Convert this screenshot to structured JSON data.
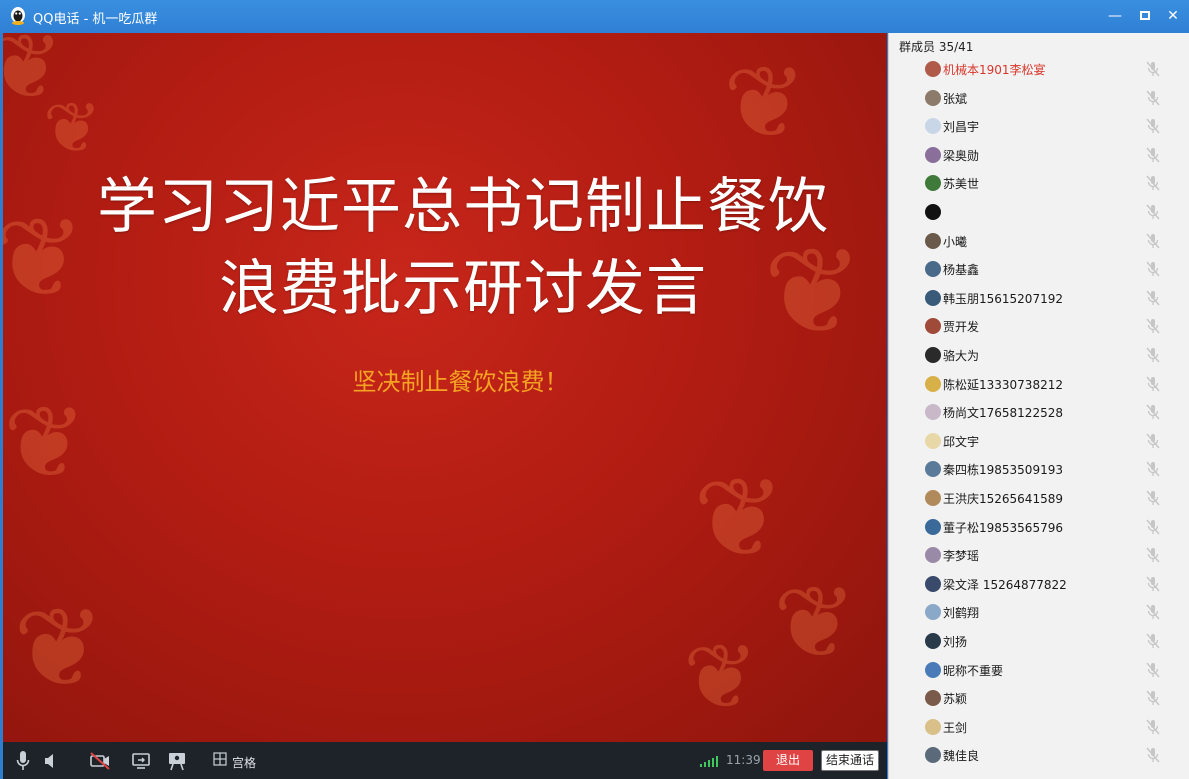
{
  "window": {
    "title": "QQ电话 - 机一吃瓜群",
    "minimize": "—",
    "close": "✕"
  },
  "slide": {
    "title_line1": "学习习近平总书记制止餐饮",
    "title_line2": "浪费批示研讨发言",
    "subtitle": "坚决制止餐饮浪费！"
  },
  "sidebar": {
    "member_count": "群成员 35/41",
    "members": [
      {
        "name": "机械本1901李松宴",
        "avatar_color": "#b05a4a"
      },
      {
        "name": "张斌",
        "avatar_color": "#8c7a6a"
      },
      {
        "name": "刘昌宇",
        "avatar_color": "#c9d6e8"
      },
      {
        "name": "梁奥勋",
        "avatar_color": "#8a6f9a"
      },
      {
        "name": "苏美世",
        "avatar_color": "#3f7a3a"
      },
      {
        "name": "",
        "avatar_color": "#111111"
      },
      {
        "name": "小曦",
        "avatar_color": "#6a5a4a"
      },
      {
        "name": "杨基鑫",
        "avatar_color": "#4a6a8a"
      },
      {
        "name": "韩玉朋15615207192",
        "avatar_color": "#3a5a7a"
      },
      {
        "name": "贾开发",
        "avatar_color": "#a04a3a"
      },
      {
        "name": "骆大为",
        "avatar_color": "#2a2a2a"
      },
      {
        "name": "陈松延13330738212",
        "avatar_color": "#d8b048"
      },
      {
        "name": "杨尚文17658122528",
        "avatar_color": "#c8b8c8"
      },
      {
        "name": "邱文宇",
        "avatar_color": "#e8d8a8"
      },
      {
        "name": "秦四栋19853509193",
        "avatar_color": "#5a7a9a"
      },
      {
        "name": "王洪庆15265641589",
        "avatar_color": "#b08a5a"
      },
      {
        "name": "董子松19853565796",
        "avatar_color": "#3a6a9a"
      },
      {
        "name": "李梦瑶",
        "avatar_color": "#9a8aa8"
      },
      {
        "name": "梁文泽 15264877822",
        "avatar_color": "#3a4a6a"
      },
      {
        "name": "刘鹤翔",
        "avatar_color": "#8aa8c8"
      },
      {
        "name": "刘扬",
        "avatar_color": "#2a3a4a"
      },
      {
        "name": "昵称不重要",
        "avatar_color": "#4a7ab8"
      },
      {
        "name": "苏颖",
        "avatar_color": "#7a5a4a"
      },
      {
        "name": "王剑",
        "avatar_color": "#d8c088"
      },
      {
        "name": "魏佳良",
        "avatar_color": "#5a6a7a"
      }
    ]
  },
  "toolbar": {
    "grid_label": "宫格",
    "time": "11:39",
    "exit_label": "退出",
    "end_call_label": "结束通话"
  },
  "colors": {
    "titlebar": "#2f80d4",
    "slide_bg": "#b11c12",
    "subtitle": "#f5a323",
    "self_name": "#d9362b",
    "exit_button": "#e04343",
    "toolbar_bg": "#1e2329"
  },
  "icons": {
    "app": "qq-penguin-icon",
    "microphone": "microphone-icon",
    "speaker": "speaker-icon",
    "camera_off": "camera-off-icon",
    "screen_share": "screen-share-icon",
    "presentation": "presentation-icon",
    "grid": "grid-icon",
    "member_mic_muted": "mic-muted-icon"
  }
}
